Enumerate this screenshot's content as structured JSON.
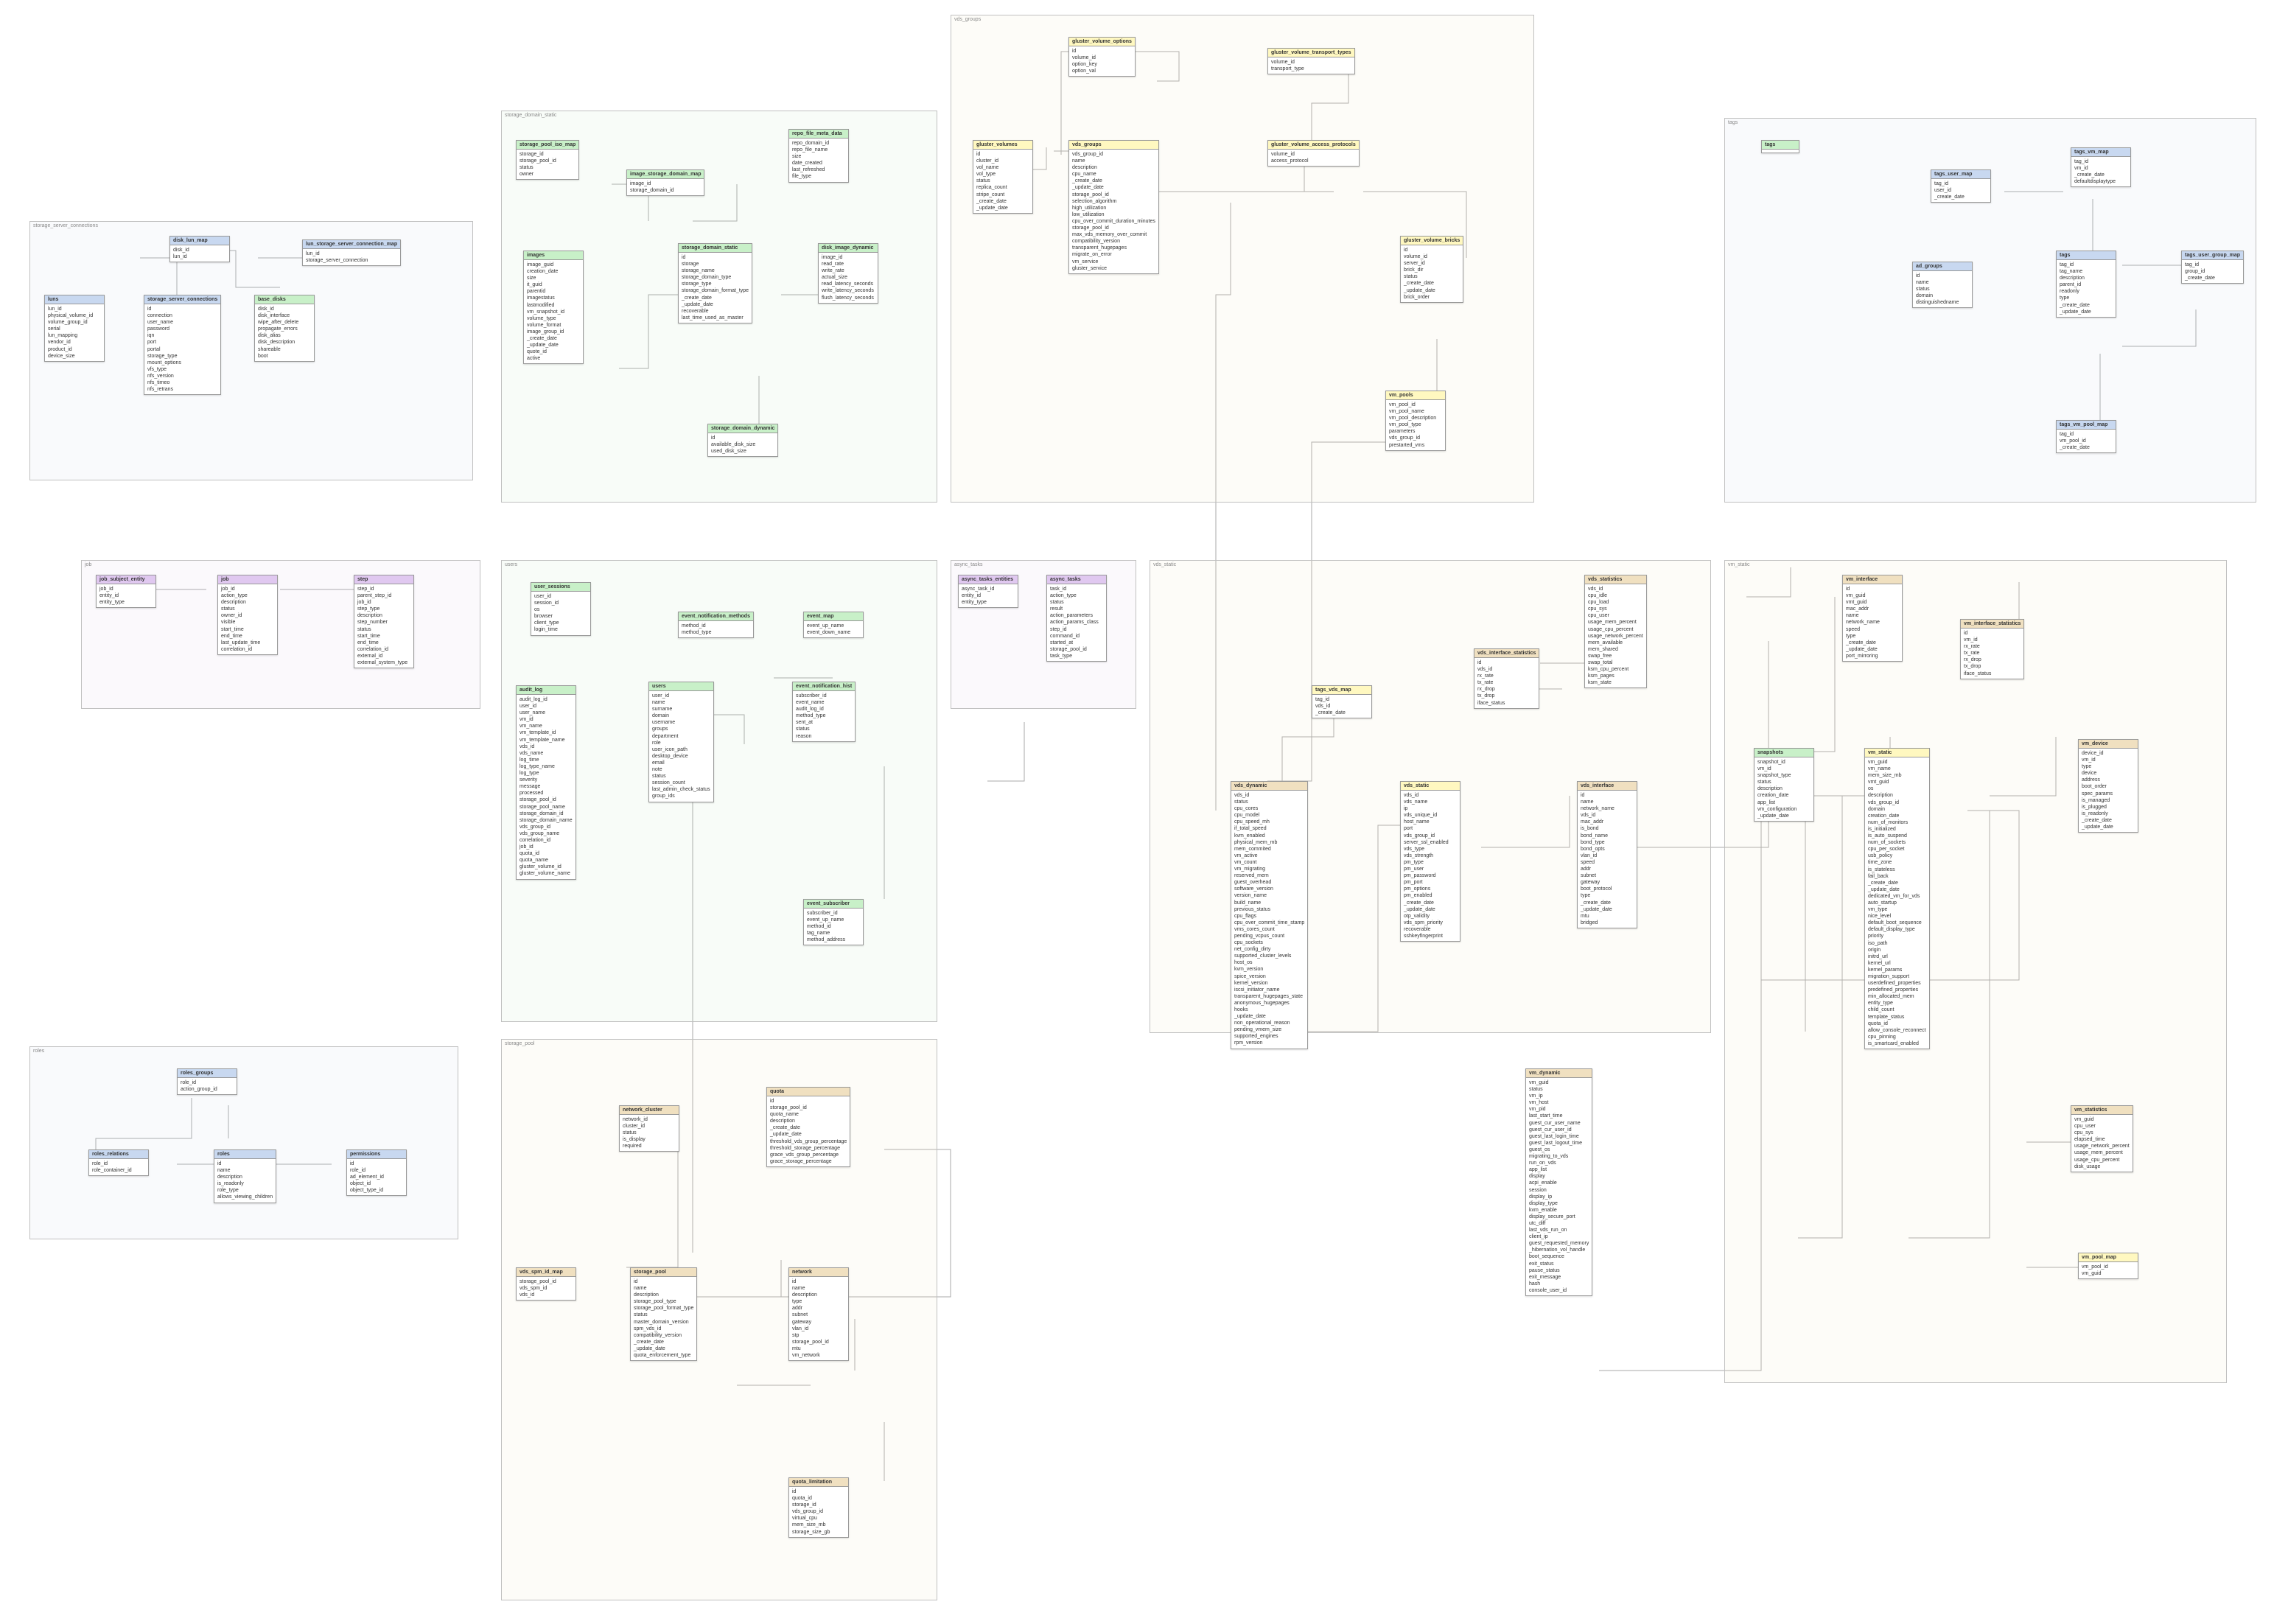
{
  "groups": {
    "storage_server_connections": "storage_server_connections",
    "job": "job",
    "roles": "roles",
    "storage_domain_static": "storage_domain_static",
    "users": "users",
    "storage_pool": "storage_pool",
    "async_tasks": "async_tasks",
    "vds_groups": "vds_groups",
    "vds_static": "vds_static",
    "vm_static": "vm_static",
    "tags": "tags"
  },
  "entities": {
    "luns": {
      "title": "luns",
      "fields": [
        "lun_id",
        "physical_volume_id",
        "volume_group_id",
        "serial",
        "lun_mapping",
        "vendor_id",
        "product_id",
        "device_size"
      ]
    },
    "disk_lun_map": {
      "title": "disk_lun_map",
      "fields": [
        "disk_id",
        "lun_id"
      ]
    },
    "lun_storage_server_connection_map": {
      "title": "lun_storage_server_connection_map",
      "fields": [
        "lun_id",
        "storage_server_connection"
      ]
    },
    "storage_server_connections_tbl": {
      "title": "storage_server_connections",
      "fields": [
        "id",
        "connection",
        "user_name",
        "password",
        "iqn",
        "port",
        "portal",
        "storage_type",
        "mount_options",
        "vfs_type",
        "nfs_version",
        "nfs_timeo",
        "nfs_retrans"
      ]
    },
    "base_disks": {
      "title": "base_disks",
      "fields": [
        "disk_id",
        "disk_interface",
        "wipe_after_delete",
        "propagate_errors",
        "disk_alias",
        "disk_description",
        "shareable",
        "boot"
      ]
    },
    "job_subject_entity": {
      "title": "job_subject_entity",
      "fields": [
        "job_id",
        "entity_id",
        "entity_type"
      ]
    },
    "job_tbl": {
      "title": "job",
      "fields": [
        "job_id",
        "action_type",
        "description",
        "status",
        "owner_id",
        "visible",
        "start_time",
        "end_time",
        "last_update_time",
        "correlation_id"
      ]
    },
    "step": {
      "title": "step",
      "fields": [
        "step_id",
        "parent_step_id",
        "job_id",
        "step_type",
        "description",
        "step_number",
        "status",
        "start_time",
        "end_time",
        "correlation_id",
        "external_id",
        "external_system_type"
      ]
    },
    "roles_groups": {
      "title": "roles_groups",
      "fields": [
        "role_id",
        "action_group_id"
      ]
    },
    "roles_relations": {
      "title": "roles_relations",
      "fields": [
        "role_id",
        "role_container_id"
      ]
    },
    "roles_tbl": {
      "title": "roles",
      "fields": [
        "id",
        "name",
        "description",
        "is_readonly",
        "role_type",
        "allows_viewing_children"
      ]
    },
    "permissions": {
      "title": "permissions",
      "fields": [
        "id",
        "role_id",
        "ad_element_id",
        "object_id",
        "object_type_id"
      ]
    },
    "storage_pool_iso_map": {
      "title": "storage_pool_iso_map",
      "fields": [
        "storage_id",
        "storage_pool_id",
        "status",
        "owner"
      ]
    },
    "image_storage_domain_map": {
      "title": "image_storage_domain_map",
      "fields": [
        "image_id",
        "storage_domain_id"
      ]
    },
    "repo_file_meta_data": {
      "title": "repo_file_meta_data",
      "fields": [
        "repo_domain_id",
        "repo_file_name",
        "size",
        "date_created",
        "last_refreshed",
        "file_type"
      ]
    },
    "images": {
      "title": "images",
      "fields": [
        "image_guid",
        "creation_date",
        "size",
        "it_guid",
        "parentid",
        "imagestatus",
        "lastmodified",
        "vm_snapshot_id",
        "volume_type",
        "volume_format",
        "image_group_id",
        "_create_date",
        "_update_date",
        "quote_id",
        "active"
      ]
    },
    "storage_domain_static_tbl": {
      "title": "storage_domain_static",
      "fields": [
        "id",
        "storage",
        "storage_name",
        "storage_domain_type",
        "storage_type",
        "storage_domain_format_type",
        "_create_date",
        "_update_date",
        "recoverable",
        "last_time_used_as_master"
      ]
    },
    "disk_image_dynamic": {
      "title": "disk_image_dynamic",
      "fields": [
        "image_id",
        "read_rate",
        "write_rate",
        "actual_size",
        "read_latency_seconds",
        "write_latency_seconds",
        "flush_latency_seconds"
      ]
    },
    "storage_domain_dynamic": {
      "title": "storage_domain_dynamic",
      "fields": [
        "id",
        "available_disk_size",
        "used_disk_size"
      ]
    },
    "user_sessions": {
      "title": "user_sessions",
      "fields": [
        "user_id",
        "session_id",
        "os",
        "browser",
        "client_type",
        "login_time"
      ]
    },
    "event_notification_methods": {
      "title": "event_notification_methods",
      "fields": [
        "method_id",
        "method_type"
      ]
    },
    "event_map": {
      "title": "event_map",
      "fields": [
        "event_up_name",
        "event_down_name"
      ]
    },
    "audit_log": {
      "title": "audit_log",
      "fields": [
        "audit_log_id",
        "user_id",
        "user_name",
        "vm_id",
        "vm_name",
        "vm_template_id",
        "vm_template_name",
        "vds_id",
        "vds_name",
        "log_time",
        "log_type_name",
        "log_type",
        "severity",
        "message",
        "processed",
        "storage_pool_id",
        "storage_pool_name",
        "storage_domain_id",
        "storage_domain_name",
        "vds_group_id",
        "vds_group_name",
        "correlation_id",
        "job_id",
        "quota_id",
        "quota_name",
        "gluster_volume_id",
        "gluster_volume_name"
      ]
    },
    "users_tbl": {
      "title": "users",
      "fields": [
        "user_id",
        "name",
        "surname",
        "domain",
        "username",
        "groups",
        "department",
        "role",
        "user_icon_path",
        "desktop_device",
        "email",
        "note",
        "status",
        "session_count",
        "last_admin_check_status",
        "group_ids"
      ]
    },
    "event_notification_hist": {
      "title": "event_notification_hist",
      "fields": [
        "subscriber_id",
        "event_name",
        "audit_log_id",
        "method_type",
        "sent_at",
        "status",
        "reason"
      ]
    },
    "event_subscriber": {
      "title": "event_subscriber",
      "fields": [
        "subscriber_id",
        "event_up_name",
        "method_id",
        "tag_name",
        "method_address"
      ]
    },
    "network_cluster": {
      "title": "network_cluster",
      "fields": [
        "network_id",
        "cluster_id",
        "status",
        "is_display",
        "required"
      ]
    },
    "quota": {
      "title": "quota",
      "fields": [
        "id",
        "storage_pool_id",
        "quota_name",
        "description",
        "_create_date",
        "_update_date",
        "threshold_vds_group_percentage",
        "threshold_storage_percentage",
        "grace_vds_group_percentage",
        "grace_storage_percentage"
      ]
    },
    "vds_spm_id_map": {
      "title": "vds_spm_id_map",
      "fields": [
        "storage_pool_id",
        "vds_spm_id",
        "vds_id"
      ]
    },
    "storage_pool_tbl": {
      "title": "storage_pool",
      "fields": [
        "id",
        "name",
        "description",
        "storage_pool_type",
        "storage_pool_format_type",
        "status",
        "master_domain_version",
        "spm_vds_id",
        "compatibility_version",
        "_create_date",
        "_update_date",
        "quota_enforcement_type"
      ]
    },
    "network": {
      "title": "network",
      "fields": [
        "id",
        "name",
        "description",
        "type",
        "addr",
        "subnet",
        "gateway",
        "vlan_id",
        "stp",
        "storage_pool_id",
        "mtu",
        "vm_network"
      ]
    },
    "quota_limitation": {
      "title": "quota_limitation",
      "fields": [
        "id",
        "quota_id",
        "storage_id",
        "vds_group_id",
        "virtual_cpu",
        "mem_size_mb",
        "storage_size_gb"
      ]
    },
    "async_tasks_entities": {
      "title": "async_tasks_entities",
      "fields": [
        "async_task_id",
        "entity_id",
        "entity_type"
      ]
    },
    "async_tasks_tbl": {
      "title": "async_tasks",
      "fields": [
        "task_id",
        "action_type",
        "status",
        "result",
        "action_parameters",
        "action_params_class",
        "step_id",
        "command_id",
        "started_at",
        "storage_pool_id",
        "task_type"
      ]
    },
    "gluster_volume_options": {
      "title": "gluster_volume_options",
      "fields": [
        "id",
        "volume_id",
        "option_key",
        "option_val"
      ]
    },
    "gluster_volume_transport_types": {
      "title": "gluster_volume_transport_types",
      "fields": [
        "volume_id",
        "transport_type"
      ]
    },
    "gluster_volumes": {
      "title": "gluster_volumes",
      "fields": [
        "id",
        "cluster_id",
        "vol_name",
        "vol_type",
        "status",
        "replica_count",
        "stripe_count",
        "_create_date",
        "_update_date"
      ]
    },
    "vds_groups_tbl": {
      "title": "vds_groups",
      "fields": [
        "vds_group_id",
        "name",
        "description",
        "cpu_name",
        "_create_date",
        "_update_date",
        "storage_pool_id",
        "selection_algorithm",
        "high_utilization",
        "low_utilization",
        "cpu_over_commit_duration_minutes",
        "storage_pool_id",
        "max_vds_memory_over_commit",
        "compatibility_version",
        "transparent_hugepages",
        "migrate_on_error",
        "vm_service",
        "gluster_service"
      ]
    },
    "gluster_volume_access_protocols": {
      "title": "gluster_volume_access_protocols",
      "fields": [
        "volume_id",
        "access_protocol"
      ]
    },
    "gluster_volume_bricks": {
      "title": "gluster_volume_bricks",
      "fields": [
        "id",
        "volume_id",
        "server_id",
        "brick_dir",
        "status",
        "_create_date",
        "_update_date",
        "brick_order"
      ]
    },
    "vm_pools": {
      "title": "vm_pools",
      "fields": [
        "vm_pool_id",
        "vm_pool_name",
        "vm_pool_description",
        "vm_pool_type",
        "parameters",
        "vds_group_id",
        "prestarted_vms"
      ]
    },
    "tags_vds_map": {
      "title": "tags_vds_map",
      "fields": [
        "tag_id",
        "vds_id",
        "_create_date"
      ]
    },
    "vds_dynamic": {
      "title": "vds_dynamic",
      "fields": [
        "vds_id",
        "status",
        "cpu_cores",
        "cpu_model",
        "cpu_speed_mh",
        "if_total_speed",
        "kvm_enabled",
        "physical_mem_mb",
        "mem_commited",
        "vm_active",
        "vm_count",
        "vm_migrating",
        "reserved_mem",
        "guest_overhead",
        "software_version",
        "version_name",
        "build_name",
        "previous_status",
        "cpu_flags",
        "cpu_over_commit_time_stamp",
        "vms_cores_count",
        "pending_vcpus_count",
        "cpu_sockets",
        "net_config_dirty",
        "supported_cluster_levels",
        "host_os",
        "kvm_version",
        "spice_version",
        "kernel_version",
        "iscsi_initiator_name",
        "transparent_hugepages_state",
        "anonymous_hugepages",
        "hooks",
        "_update_date",
        "non_operational_reason",
        "pending_vmem_size",
        "supported_engines",
        "rpm_version"
      ]
    },
    "vds_static_tbl": {
      "title": "vds_static",
      "fields": [
        "vds_id",
        "vds_name",
        "ip",
        "vds_unique_id",
        "host_name",
        "port",
        "vds_group_id",
        "server_ssl_enabled",
        "vds_type",
        "vds_strength",
        "pm_type",
        "pm_user",
        "pm_password",
        "pm_port",
        "pm_options",
        "pm_enabled",
        "_create_date",
        "_update_date",
        "otp_validity",
        "vds_spm_priority",
        "recoverable",
        "sshkeyfingerprint"
      ]
    },
    "vds_interface_statistics": {
      "title": "vds_interface_statistics",
      "fields": [
        "id",
        "vds_id",
        "rx_rate",
        "tx_rate",
        "rx_drop",
        "tx_drop",
        "iface_status"
      ]
    },
    "vds_statistics": {
      "title": "vds_statistics",
      "fields": [
        "vds_id",
        "cpu_idle",
        "cpu_load",
        "cpu_sys",
        "cpu_user",
        "usage_mem_percent",
        "usage_cpu_percent",
        "usage_network_percent",
        "mem_available",
        "mem_shared",
        "swap_free",
        "swap_total",
        "ksm_cpu_percent",
        "ksm_pages",
        "ksm_state"
      ]
    },
    "vds_interface": {
      "title": "vds_interface",
      "fields": [
        "id",
        "name",
        "network_name",
        "vds_id",
        "mac_addr",
        "is_bond",
        "bond_name",
        "bond_type",
        "bond_opts",
        "vlan_id",
        "speed",
        "addr",
        "subnet",
        "gateway",
        "boot_protocol",
        "type",
        "_create_date",
        "_update_date",
        "mtu",
        "bridged"
      ]
    },
    "vm_dynamic": {
      "title": "vm_dynamic",
      "fields": [
        "vm_guid",
        "status",
        "vm_ip",
        "vm_host",
        "vm_pid",
        "last_start_time",
        "guest_cur_user_name",
        "guest_cur_user_id",
        "guest_last_login_time",
        "guest_last_logout_time",
        "guest_os",
        "migrating_to_vds",
        "run_on_vds",
        "app_list",
        "display",
        "acpi_enable",
        "session",
        "display_ip",
        "display_type",
        "kvm_enable",
        "display_secure_port",
        "utc_diff",
        "last_vds_run_on",
        "client_ip",
        "guest_requested_memory",
        "_hibernation_vol_handle",
        "boot_sequence",
        "exit_status",
        "pause_status",
        "exit_message",
        "hash",
        "console_user_id"
      ]
    },
    "vm_interface": {
      "title": "vm_interface",
      "fields": [
        "id",
        "vm_guid",
        "vmt_guid",
        "mac_addr",
        "name",
        "network_name",
        "speed",
        "type",
        "_create_date",
        "_update_date",
        "port_mirroring"
      ]
    },
    "vm_interface_statistics": {
      "title": "vm_interface_statistics",
      "fields": [
        "id",
        "vm_id",
        "rx_rate",
        "tx_rate",
        "rx_drop",
        "tx_drop",
        "iface_status"
      ]
    },
    "snapshots": {
      "title": "snapshots",
      "fields": [
        "snapshot_id",
        "vm_id",
        "snapshot_type",
        "status",
        "description",
        "creation_date",
        "app_list",
        "vm_configuration",
        "_update_date"
      ]
    },
    "vm_static_tbl": {
      "title": "vm_static",
      "fields": [
        "vm_guid",
        "vm_name",
        "mem_size_mb",
        "vmt_guid",
        "os",
        "description",
        "vds_group_id",
        "domain",
        "creation_date",
        "num_of_monitors",
        "is_initialized",
        "is_auto_suspend",
        "num_of_sockets",
        "cpu_per_socket",
        "usb_policy",
        "time_zone",
        "is_stateless",
        "fail_back",
        "_create_date",
        "_update_date",
        "dedicated_vm_for_vds",
        "auto_startup",
        "vm_type",
        "nice_level",
        "default_boot_sequence",
        "default_display_type",
        "priority",
        "iso_path",
        "origin",
        "initrd_url",
        "kernel_url",
        "kernel_params",
        "migration_support",
        "userdefined_properties",
        "predefined_properties",
        "min_allocated_mem",
        "entity_type",
        "child_count",
        "template_status",
        "quota_id",
        "allow_console_reconnect",
        "cpu_pinning",
        "is_smartcard_enabled"
      ]
    },
    "vm_device": {
      "title": "vm_device",
      "fields": [
        "device_id",
        "vm_id",
        "type",
        "device",
        "address",
        "boot_order",
        "spec_params",
        "is_managed",
        "is_plugged",
        "is_readonly",
        "_create_date",
        "_update_date"
      ]
    },
    "vm_statistics": {
      "title": "vm_statistics",
      "fields": [
        "vm_guid",
        "cpu_user",
        "cpu_sys",
        "elapsed_time",
        "usage_network_percent",
        "usage_mem_percent",
        "usage_cpu_percent",
        "disk_usage"
      ]
    },
    "vm_pool_map": {
      "title": "vm_pool_map",
      "fields": [
        "vm_pool_id",
        "vm_guid"
      ]
    },
    "tags_user_map": {
      "title": "tags_user_map",
      "fields": [
        "tag_id",
        "user_id",
        "_create_date"
      ]
    },
    "tags_vm_map": {
      "title": "tags_vm_map",
      "fields": [
        "tag_id",
        "vm_id",
        "_create_date",
        "defaultdisplaytype"
      ]
    },
    "tags_user_group_map": {
      "title": "tags_user_group_map",
      "fields": [
        "tag_id",
        "group_id",
        "_create_date"
      ]
    },
    "ad_groups": {
      "title": "ad_groups",
      "fields": [
        "id",
        "name",
        "status",
        "domain",
        "distinguishedname"
      ]
    },
    "tags_tbl": {
      "title": "tags",
      "fields": [
        "tag_id",
        "tag_name",
        "description",
        "parent_id",
        "readonly",
        "type",
        "_create_date",
        "_update_date"
      ]
    },
    "tags_vm_pool_map": {
      "title": "tags_vm_pool_map",
      "fields": [
        "tag_id",
        "vm_pool_id",
        "_create_date"
      ]
    }
  }
}
